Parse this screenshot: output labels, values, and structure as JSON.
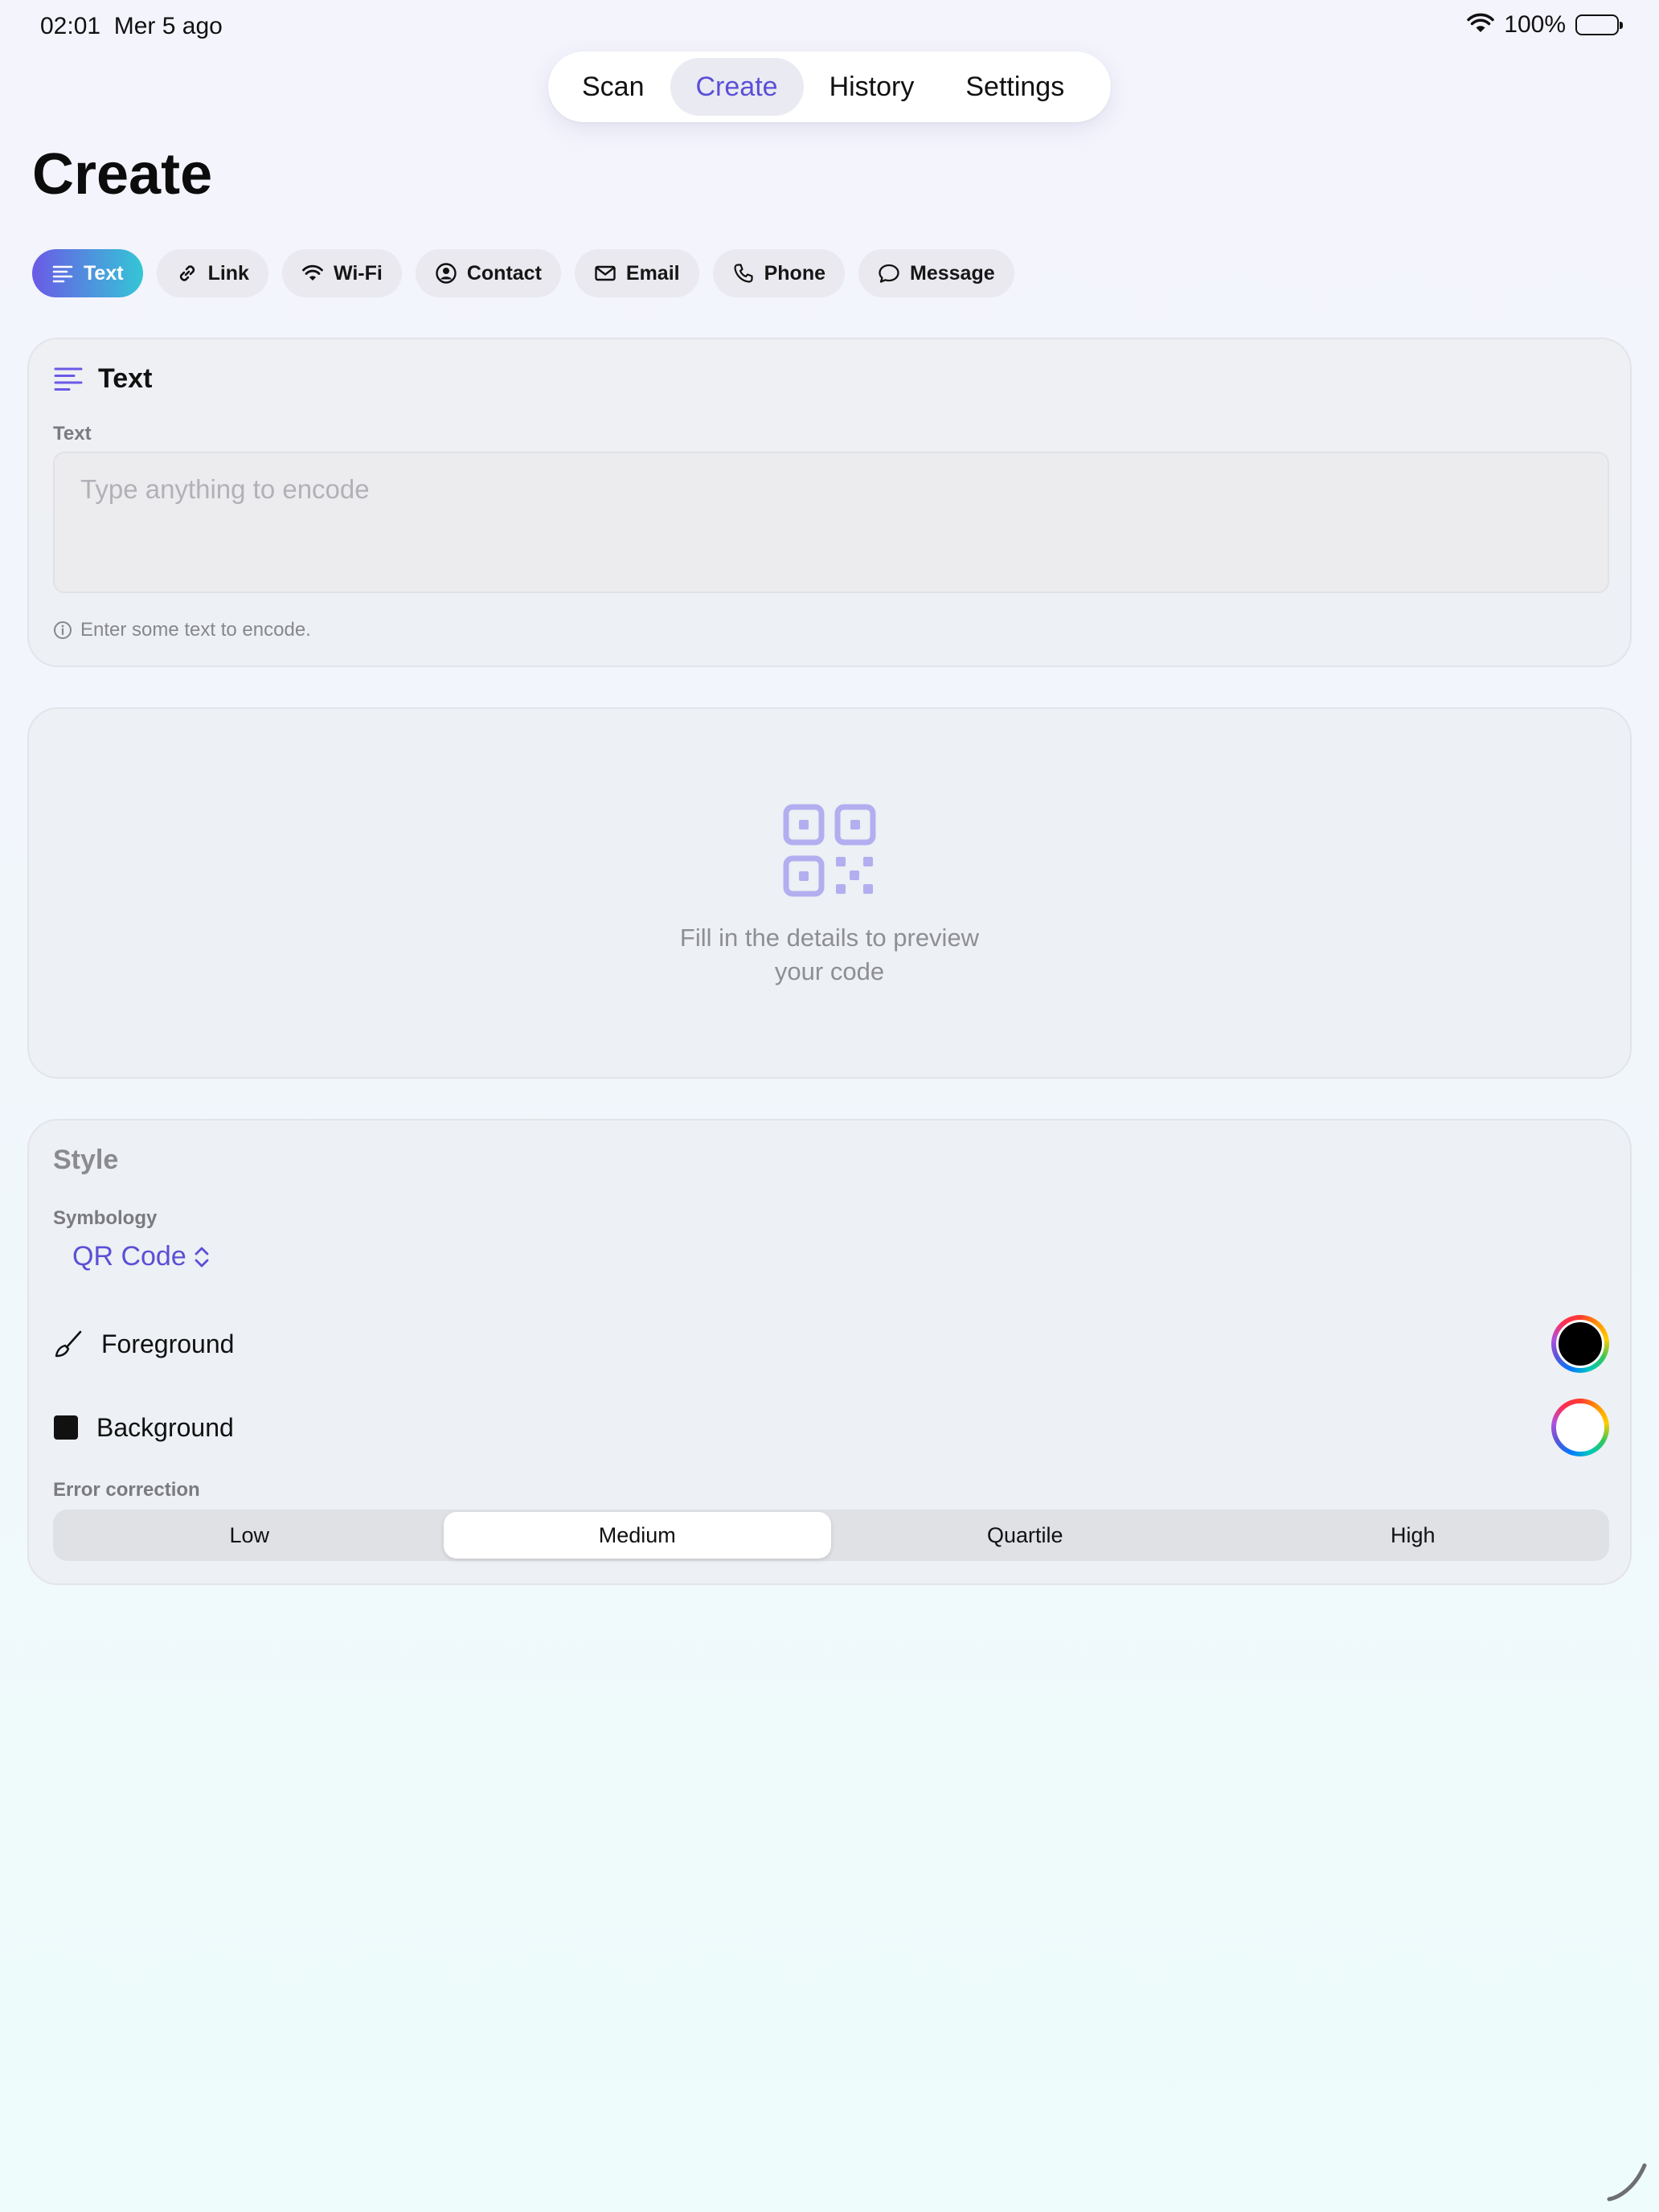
{
  "status_bar": {
    "time": "02:01",
    "date": "Mer 5 ago",
    "battery": "100%"
  },
  "nav": {
    "tabs": [
      "Scan",
      "Create",
      "History",
      "Settings"
    ],
    "active": "Create"
  },
  "page": {
    "title": "Create"
  },
  "types": [
    {
      "label": "Text",
      "icon": "text-lines-icon",
      "active": true
    },
    {
      "label": "Link",
      "icon": "link-icon"
    },
    {
      "label": "Wi-Fi",
      "icon": "wifi-icon"
    },
    {
      "label": "Contact",
      "icon": "person-circle-icon"
    },
    {
      "label": "Email",
      "icon": "envelope-icon"
    },
    {
      "label": "Phone",
      "icon": "phone-icon"
    },
    {
      "label": "Message",
      "icon": "message-bubble-icon"
    }
  ],
  "text_card": {
    "title": "Text",
    "field_label": "Text",
    "placeholder": "Type anything to encode",
    "helper": "Enter some text to encode."
  },
  "preview": {
    "message_line1": "Fill in the details to preview",
    "message_line2": "your code"
  },
  "style": {
    "title": "Style",
    "symbology_label": "Symbology",
    "symbology_value": "QR Code",
    "foreground_label": "Foreground",
    "foreground_color": "#000000",
    "background_label": "Background",
    "background_color": "#ffffff",
    "error_correction_label": "Error correction",
    "error_levels": [
      "Low",
      "Medium",
      "Quartile",
      "High"
    ],
    "error_selected": "Medium"
  },
  "colors": {
    "accent": "#5b4fd6",
    "chip_gradient_start": "#6a5ae6",
    "chip_gradient_end": "#34c6d6"
  }
}
